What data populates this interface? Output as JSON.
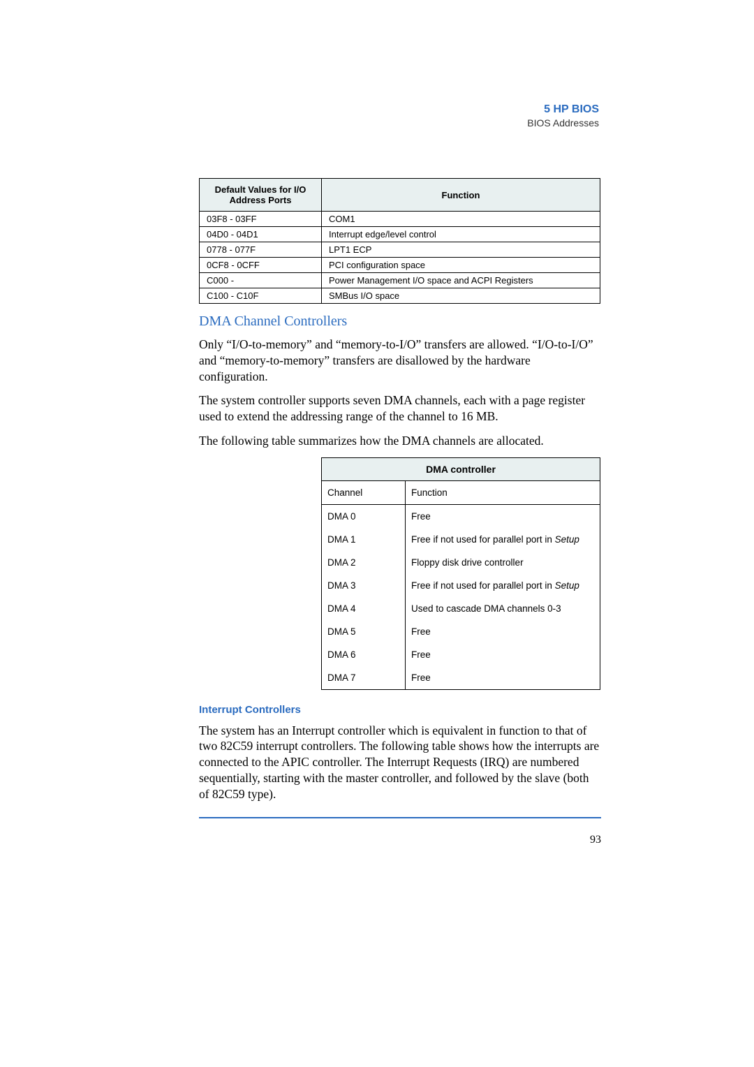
{
  "header": {
    "chapter": "5   HP BIOS",
    "section": "BIOS Addresses"
  },
  "io_table": {
    "headers": [
      "Default Values for I/O Address Ports",
      "Function"
    ],
    "rows": [
      [
        "03F8 - 03FF",
        "COM1"
      ],
      [
        "04D0 - 04D1",
        "Interrupt edge/level control"
      ],
      [
        "0778 - 077F",
        "LPT1 ECP"
      ],
      [
        "0CF8 - 0CFF",
        "PCI configuration space"
      ],
      [
        "C000 -",
        "Power Management I/O space and ACPI Registers"
      ],
      [
        "C100 - C10F",
        "SMBus I/O space"
      ]
    ]
  },
  "dma_heading": "DMA Channel Controllers",
  "dma_para1": "Only “I/O-to-memory” and “memory-to-I/O” transfers are allowed. “I/O-to-I/O” and “memory-to-memory” transfers are disallowed by the hardware configuration.",
  "dma_para2": "The system controller supports seven DMA channels, each with a page register used to extend the addressing range of the channel to 16 MB.",
  "dma_para3": "The following table summarizes how the DMA channels are allocated.",
  "dma_table": {
    "title": "DMA controller",
    "subheads": [
      "Channel",
      "Function"
    ],
    "rows": [
      [
        "DMA 0",
        "Free"
      ],
      [
        "DMA 1",
        "Free if not used for parallel port in "
      ],
      [
        "DMA 2",
        "Floppy disk drive controller"
      ],
      [
        "DMA 3",
        "Free if not used for parallel port in "
      ],
      [
        "DMA 4",
        "Used to cascade DMA channels 0-3"
      ],
      [
        "DMA 5",
        "Free"
      ],
      [
        "DMA 6",
        "Free"
      ],
      [
        "DMA 7",
        "Free"
      ]
    ],
    "setup_word": "Setup"
  },
  "int_heading": "Interrupt Controllers",
  "int_para": "The system has an Interrupt controller which is equivalent in function to that of two 82C59 interrupt controllers. The following table shows how the interrupts are connected to the APIC controller. The Interrupt Requests (IRQ) are numbered sequentially, starting with the master controller, and followed by the slave (both of 82C59 type).",
  "page_number": "93"
}
